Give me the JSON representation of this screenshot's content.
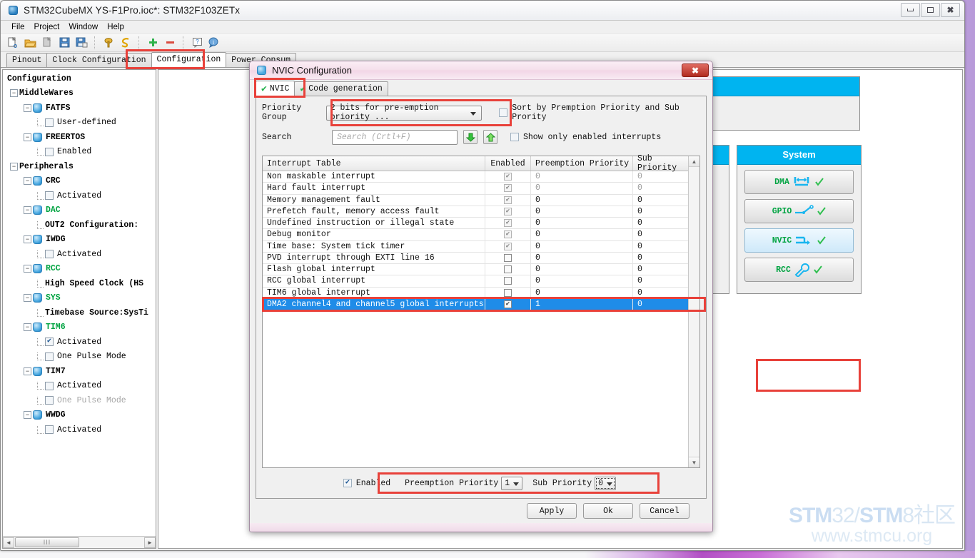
{
  "window": {
    "title": "STM32CubeMX YS-F1Pro.ioc*: STM32F103ZETx",
    "icon": "cube-icon",
    "minimize_label": "–",
    "maximize_label": "□",
    "close_label": "✕"
  },
  "menubar": {
    "items": [
      "File",
      "Project",
      "Window",
      "Help"
    ]
  },
  "toolbar": {
    "icons": [
      "new-project-icon",
      "open-project-icon",
      "copy-icon",
      "save-icon",
      "save-as-icon",
      "generate-report-icon",
      "generate-code-icon",
      "add-icon",
      "remove-icon",
      "help-icon",
      "about-icon"
    ]
  },
  "tabs": {
    "items": [
      {
        "label": "Pinout",
        "active": false
      },
      {
        "label": "Clock Configuration",
        "active": false
      },
      {
        "label": "Configuration",
        "active": true
      },
      {
        "label": "Power Consum",
        "active": false
      }
    ]
  },
  "sidebar": {
    "root_label": "Configuration",
    "nodes": [
      {
        "label": "MiddleWares",
        "depth": 0,
        "kind": "group",
        "expander": "−"
      },
      {
        "label": "FATFS",
        "depth": 1,
        "kind": "chip",
        "expander": "−",
        "style": "bold"
      },
      {
        "label": "User-defined",
        "depth": 2,
        "kind": "check",
        "checked": false
      },
      {
        "label": "FREERTOS",
        "depth": 1,
        "kind": "chip",
        "expander": "−",
        "style": "bold"
      },
      {
        "label": "Enabled",
        "depth": 2,
        "kind": "check",
        "checked": false
      },
      {
        "label": "Peripherals",
        "depth": 0,
        "kind": "group",
        "expander": "−"
      },
      {
        "label": "CRC",
        "depth": 1,
        "kind": "chip",
        "expander": "−",
        "style": "bold"
      },
      {
        "label": "Activated",
        "depth": 2,
        "kind": "check",
        "checked": false
      },
      {
        "label": "DAC",
        "depth": 1,
        "kind": "chip",
        "expander": "−",
        "style": "green"
      },
      {
        "label": "OUT2 Configuration:",
        "depth": 2,
        "kind": "text",
        "style": "bold"
      },
      {
        "label": "IWDG",
        "depth": 1,
        "kind": "chip",
        "expander": "−",
        "style": "bold"
      },
      {
        "label": "Activated",
        "depth": 2,
        "kind": "check",
        "checked": false
      },
      {
        "label": "RCC",
        "depth": 1,
        "kind": "chip",
        "expander": "−",
        "style": "green"
      },
      {
        "label": "High Speed Clock (HS",
        "depth": 2,
        "kind": "text",
        "style": "bold"
      },
      {
        "label": "SYS",
        "depth": 1,
        "kind": "chip",
        "expander": "−",
        "style": "green"
      },
      {
        "label": "Timebase Source:SysTi",
        "depth": 2,
        "kind": "text",
        "style": "bold"
      },
      {
        "label": "TIM6",
        "depth": 1,
        "kind": "chip",
        "expander": "−",
        "style": "green"
      },
      {
        "label": "Activated",
        "depth": 2,
        "kind": "check",
        "checked": true
      },
      {
        "label": "One Pulse Mode",
        "depth": 2,
        "kind": "check",
        "checked": false
      },
      {
        "label": "TIM7",
        "depth": 1,
        "kind": "chip",
        "expander": "−",
        "style": "bold"
      },
      {
        "label": "Activated",
        "depth": 2,
        "kind": "check",
        "checked": false
      },
      {
        "label": "One Pulse Mode",
        "depth": 2,
        "kind": "check",
        "checked": false,
        "style": "dim"
      },
      {
        "label": "WWDG",
        "depth": 1,
        "kind": "chip",
        "expander": "−",
        "style": "bold"
      },
      {
        "label": "Activated",
        "depth": 2,
        "kind": "check",
        "checked": false
      }
    ],
    "hscroll": {
      "left_arrow": "◄",
      "right_arrow": "►",
      "grip": "‖‖"
    }
  },
  "canvas": {
    "system_panel": {
      "title": "System",
      "buttons": [
        {
          "label": "DMA",
          "icon": "dma-icon",
          "selected": false,
          "check": true
        },
        {
          "label": "GPIO",
          "icon": "gpio-icon",
          "selected": false,
          "check": true
        },
        {
          "label": "NVIC",
          "icon": "nvic-icon",
          "selected": true,
          "check": true
        },
        {
          "label": "RCC",
          "icon": "rcc-wrench-icon",
          "selected": false,
          "check": true
        }
      ]
    }
  },
  "watermark": {
    "line1_a": "STM",
    "line1_b": "32/",
    "line1_c": "STM",
    "line1_d": "8社区",
    "line2": "www.stmcu.org"
  },
  "dialog": {
    "title": "NVIC Configuration",
    "icon": "cube-icon",
    "close_label": "✕",
    "tabs": [
      {
        "label": "NVIC",
        "active": true,
        "tick": "✔"
      },
      {
        "label": "Code generation",
        "active": false,
        "tick": "✔"
      }
    ],
    "priority_group": {
      "label": "Priority Group",
      "value": "2 bits for pre-emption priority ...",
      "sort_checkbox_label": "Sort by Premption Priority and Sub Prority",
      "sort_checked": false
    },
    "search": {
      "label": "Search",
      "placeholder": "Search (Crtl+F)",
      "value": "",
      "down_icon": "arrow-down-icon",
      "up_icon": "arrow-up-icon",
      "show_only_enabled_label": "Show only enabled interrupts",
      "show_only_enabled_checked": false
    },
    "table": {
      "columns": [
        "Interrupt Table",
        "Enabled",
        "Preemption Priority",
        "Sub Priority"
      ],
      "rows": [
        {
          "name": "Non maskable interrupt",
          "enabled": true,
          "locked": true,
          "pre": "0",
          "sub": "0",
          "dim": true
        },
        {
          "name": "Hard fault interrupt",
          "enabled": true,
          "locked": true,
          "pre": "0",
          "sub": "0",
          "dim": true
        },
        {
          "name": "Memory management fault",
          "enabled": true,
          "locked": true,
          "pre": "0",
          "sub": "0",
          "dim": false
        },
        {
          "name": "Prefetch fault, memory access fault",
          "enabled": true,
          "locked": true,
          "pre": "0",
          "sub": "0",
          "dim": false
        },
        {
          "name": "Undefined instruction or illegal state",
          "enabled": true,
          "locked": true,
          "pre": "0",
          "sub": "0",
          "dim": false
        },
        {
          "name": "Debug monitor",
          "enabled": true,
          "locked": true,
          "pre": "0",
          "sub": "0",
          "dim": false
        },
        {
          "name": "Time base: System tick timer",
          "enabled": true,
          "locked": true,
          "pre": "0",
          "sub": "0",
          "dim": false
        },
        {
          "name": "PVD interrupt through EXTI line 16",
          "enabled": false,
          "locked": false,
          "pre": "0",
          "sub": "0",
          "dim": false
        },
        {
          "name": "Flash global interrupt",
          "enabled": false,
          "locked": false,
          "pre": "0",
          "sub": "0",
          "dim": false
        },
        {
          "name": "RCC global interrupt",
          "enabled": false,
          "locked": false,
          "pre": "0",
          "sub": "0",
          "dim": false
        },
        {
          "name": "TIM6 global interrupt",
          "enabled": false,
          "locked": false,
          "pre": "0",
          "sub": "0",
          "dim": false
        },
        {
          "name": "DMA2 channel4 and channel5 global interrupts",
          "enabled": true,
          "locked": false,
          "pre": "1",
          "sub": "0",
          "dim": false,
          "selected": true
        }
      ],
      "scroll_up": "▲",
      "scroll_down": "▼"
    },
    "editor": {
      "enabled_label": "Enabled",
      "enabled_checked": true,
      "preemption_label": "Preemption Priority",
      "preemption_value": "1",
      "sub_label": "Sub Priority",
      "sub_value": "0"
    },
    "buttons": [
      {
        "label": "Apply"
      },
      {
        "label": "Ok"
      },
      {
        "label": "Cancel"
      }
    ]
  }
}
